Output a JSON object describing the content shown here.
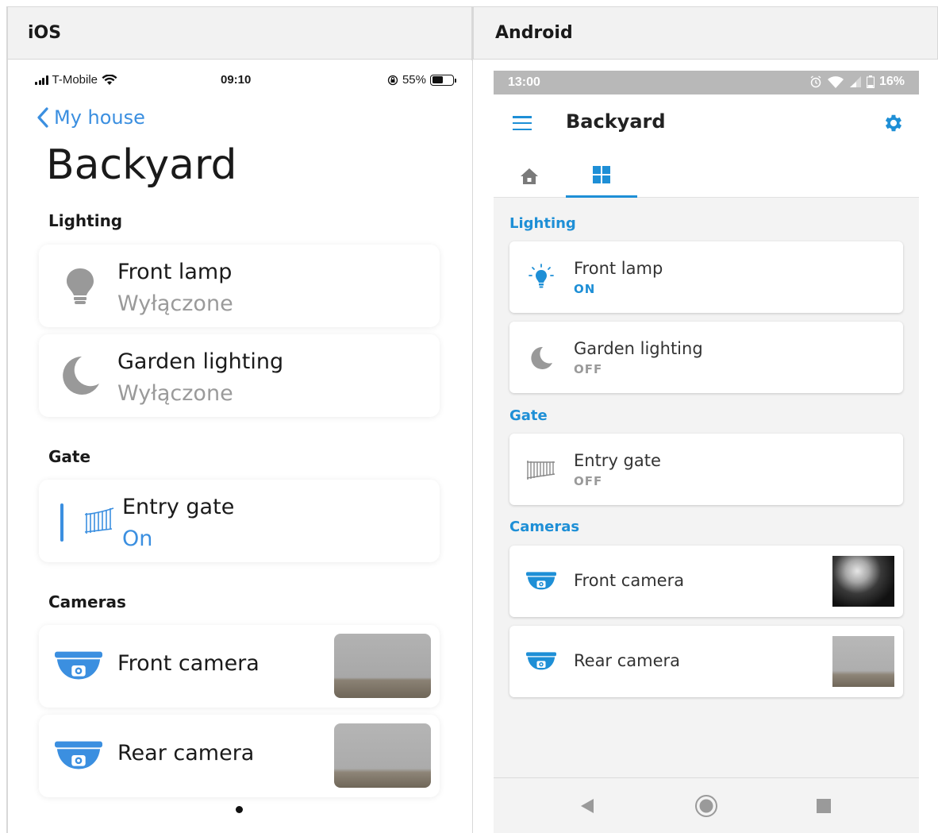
{
  "headers": {
    "ios": "iOS",
    "android": "Android"
  },
  "ios": {
    "status": {
      "carrier": "T-Mobile",
      "time": "09:10",
      "battery": "55%"
    },
    "back_label": "My house",
    "title": "Backyard",
    "sections": {
      "lighting": "Lighting",
      "gate": "Gate",
      "cameras": "Cameras"
    },
    "devices": {
      "front_lamp": {
        "name": "Front lamp",
        "state": "Wyłączone",
        "icon": "lightbulb-icon"
      },
      "garden_lighting": {
        "name": "Garden lighting",
        "state": "Wyłączone",
        "icon": "moon-icon"
      },
      "entry_gate": {
        "name": "Entry gate",
        "state": "On",
        "icon": "gate-icon"
      },
      "front_camera": {
        "name": "Front camera",
        "icon": "camera-icon"
      },
      "rear_camera": {
        "name": "Rear camera",
        "icon": "camera-icon"
      }
    },
    "accent": "#3b8fe0"
  },
  "android": {
    "status": {
      "time": "13:00",
      "battery": "16%"
    },
    "title": "Backyard",
    "tabs": [
      "home-tab",
      "grid-tab"
    ],
    "sections": {
      "lighting": "Lighting",
      "gate": "Gate",
      "cameras": "Cameras"
    },
    "devices": {
      "front_lamp": {
        "name": "Front lamp",
        "state": "ON",
        "icon": "lightbulb-on-icon"
      },
      "garden_lighting": {
        "name": "Garden lighting",
        "state": "OFF",
        "icon": "moon-icon"
      },
      "entry_gate": {
        "name": "Entry gate",
        "state": "OFF",
        "icon": "gate-icon"
      },
      "front_camera": {
        "name": "Front camera",
        "icon": "camera-icon"
      },
      "rear_camera": {
        "name": "Rear camera",
        "icon": "camera-icon"
      }
    },
    "accent": "#1e8fd6"
  }
}
